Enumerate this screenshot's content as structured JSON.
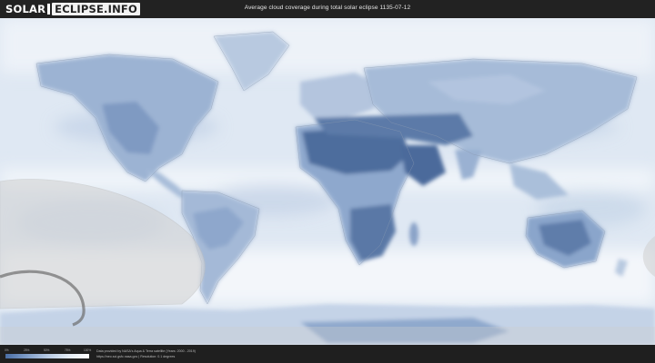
{
  "header": {
    "logo_part1": "SOLAR",
    "logo_part2": "ECLIPSE.INFO",
    "title": "Average cloud coverage during total solar eclipse 1135-07-12"
  },
  "legend": {
    "ticks": [
      "0%",
      "25%",
      "50%",
      "75%",
      "100%"
    ],
    "colors": [
      "#4a6ea5",
      "#7e9cc7",
      "#b6c9e2",
      "#e3ebf5",
      "#ffffff"
    ]
  },
  "credits": {
    "line1": "Data provided by NASA's Aqua & Terra satellite (Years: 2000 - 2019)",
    "line2": "https://neo.sci.gsfc.nasa.gov | Resolution: 0.1 degrees"
  },
  "map": {
    "type": "world cloud-cover map",
    "land_dark_color": "#4d6c9c",
    "land_mid_color": "#8aa6cc",
    "cloud_light_color": "#edf2f8",
    "eclipse_path_color": "#d9d9d9",
    "eclipse_outline_color": "#6e6e6e"
  }
}
